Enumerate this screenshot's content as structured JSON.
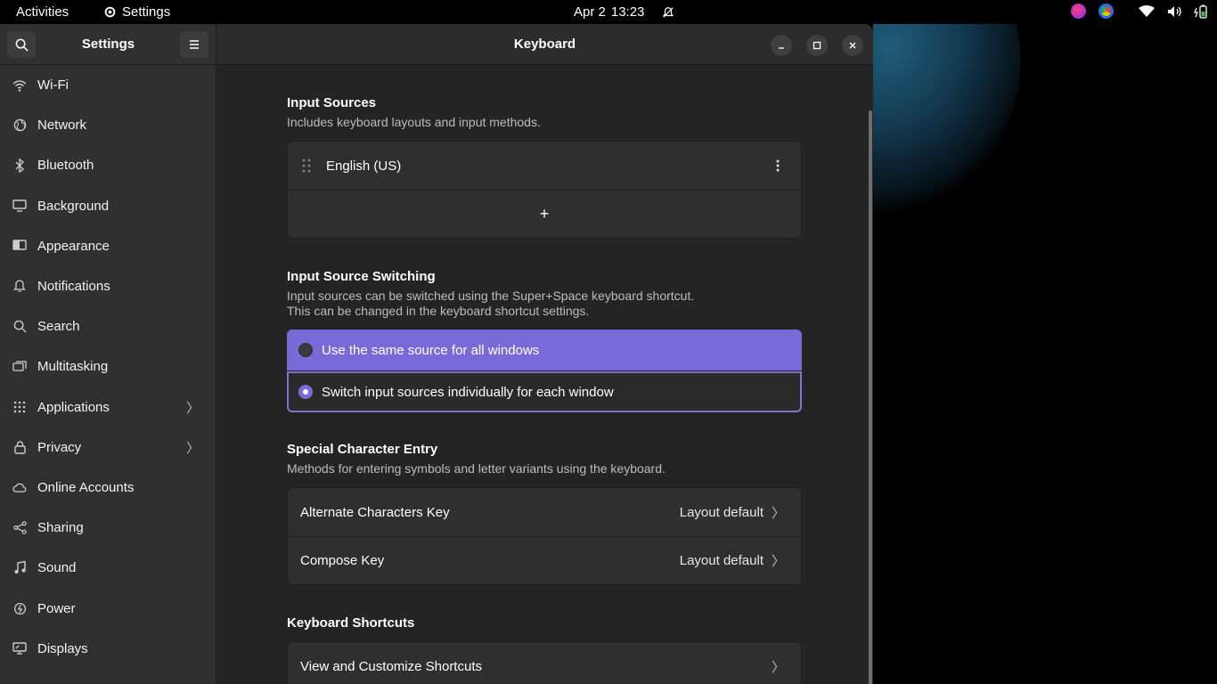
{
  "topbar": {
    "activities": "Activities",
    "app_name": "Settings",
    "date": "Apr 2",
    "time": "13:23",
    "icons": [
      "bell-muted-icon",
      "firefox-icon",
      "chrome-icon",
      "wifi-icon",
      "volume-icon",
      "battery-icon"
    ]
  },
  "sidebar": {
    "title": "Settings",
    "items": [
      {
        "label": "Wi-Fi",
        "icon": "wifi-icon"
      },
      {
        "label": "Network",
        "icon": "globe-icon"
      },
      {
        "label": "Bluetooth",
        "icon": "bluetooth-icon"
      },
      {
        "label": "Background",
        "icon": "monitor-icon"
      },
      {
        "label": "Appearance",
        "icon": "appearance-icon"
      },
      {
        "label": "Notifications",
        "icon": "bell-icon"
      },
      {
        "label": "Search",
        "icon": "search-icon"
      },
      {
        "label": "Multitasking",
        "icon": "multitasking-icon"
      },
      {
        "label": "Applications",
        "icon": "grid-icon"
      },
      {
        "label": "Privacy",
        "icon": "lock-icon"
      },
      {
        "label": "Online Accounts",
        "icon": "cloud-icon"
      },
      {
        "label": "Sharing",
        "icon": "share-icon"
      },
      {
        "label": "Sound",
        "icon": "music-note-icon"
      },
      {
        "label": "Power",
        "icon": "power-icon"
      },
      {
        "label": "Displays",
        "icon": "display-icon"
      }
    ]
  },
  "window": {
    "title": "Keyboard"
  },
  "input_sources": {
    "title": "Input Sources",
    "subtitle": "Includes keyboard layouts and input methods.",
    "sources": [
      "English (US)"
    ],
    "add_label": "+"
  },
  "switching": {
    "title": "Input Source Switching",
    "subtitle_line1": "Input sources can be switched using the Super+Space keyboard shortcut.",
    "subtitle_line2": "This can be changed in the keyboard shortcut settings.",
    "option_same": "Use the same source for all windows",
    "option_individual": "Switch input sources individually for each window",
    "selected": "individual"
  },
  "special": {
    "title": "Special Character Entry",
    "subtitle": "Methods for entering symbols and letter variants using the keyboard.",
    "alternate_label": "Alternate Characters Key",
    "alternate_value": "Layout default",
    "compose_label": "Compose Key",
    "compose_value": "Layout default"
  },
  "shortcuts": {
    "title": "Keyboard Shortcuts",
    "view_label": "View and Customize Shortcuts"
  },
  "colors": {
    "accent": "#7a6ad8",
    "accent_highlight": "#8070d8",
    "window_bg": "#242424",
    "sidebar_bg": "#303030"
  }
}
